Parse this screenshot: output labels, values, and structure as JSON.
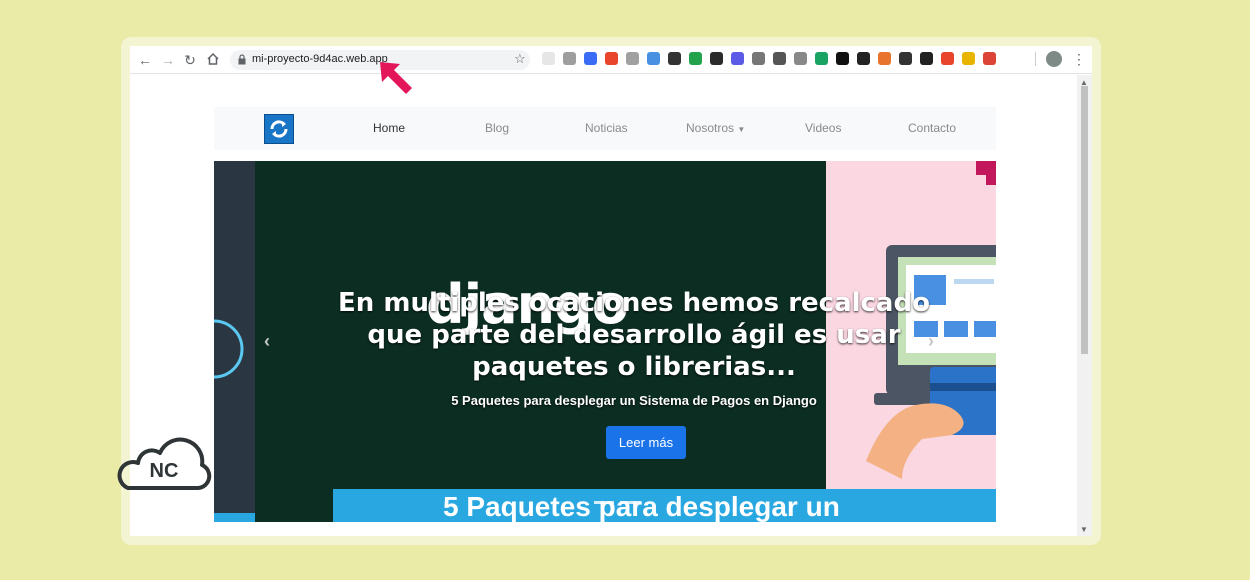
{
  "browser": {
    "url": "mi-proyecto-9d4ac.web.app",
    "nav_icons": [
      "back-arrow-icon",
      "forward-arrow-icon",
      "reload-icon",
      "home-icon"
    ],
    "extension_colors": [
      "#e6e6e6",
      "#9e9e9e",
      "#3b6cf6",
      "#e8452c",
      "#a0a0a0",
      "#4a90e2",
      "#333333",
      "#22a24b",
      "#2b2b2b",
      "#5b5be8",
      "#777777",
      "#555555",
      "#888888",
      "#19a463",
      "#111111",
      "#222222",
      "#e8732c",
      "#333333",
      "#222222",
      "#e8452c",
      "#e7b400",
      "#db4437"
    ]
  },
  "site": {
    "nav": {
      "home": "Home",
      "blog": "Blog",
      "news": "Noticias",
      "about": "Nosotros",
      "videos": "Videos",
      "contact": "Contacto"
    },
    "hero": {
      "django_word": "django",
      "headline_line1": "En multiples ocaciones hemos recalcado",
      "headline_line2": "que parte del desarrollo ágil es usar",
      "headline_line3": "paquetes o librerias...",
      "subtitle": "5 Paquetes para desplegar un Sistema de Pagos en Django",
      "button": "Leer más",
      "banner_text": "5 Paquetes para desplegar un"
    }
  },
  "overlay": {
    "logo_text": "NC",
    "arrow_color": "#e4165a"
  },
  "colors": {
    "brand_blue": "#1976c7",
    "button_blue": "#1a73e8",
    "page_bg": "#e9eba6"
  }
}
